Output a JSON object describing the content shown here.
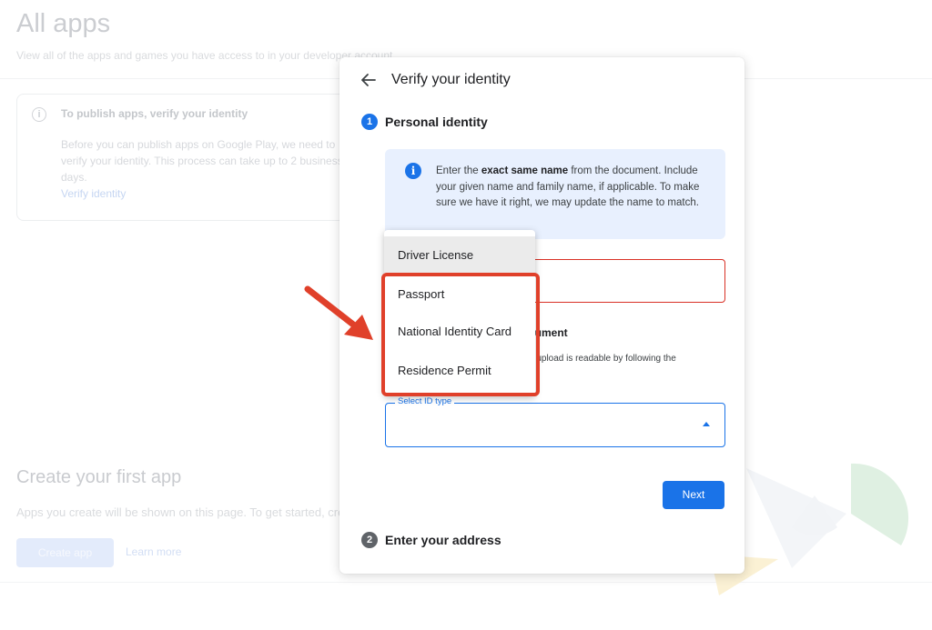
{
  "background": {
    "title": "All apps",
    "subtitle": "View all of the apps and games you have access to in your developer account",
    "notice": {
      "title": "To publish apps, verify your identity",
      "text": "Before you can publish apps on Google Play, we need to verify your identity. This process can take up to 2 business days.",
      "link": "Verify identity"
    },
    "create": {
      "title": "Create your first app",
      "text": "Apps you create will be shown on this page. To get started, create your first app.",
      "button": "Create app",
      "link": "Learn more"
    }
  },
  "modal": {
    "title": "Verify your identity",
    "step1": {
      "number": "1",
      "label": "Personal identity"
    },
    "info": {
      "prefix": "Enter the ",
      "bold": "exact same name",
      "suffix": " from the document. Include your given name and family name, if applicable. To make sure we have it right, we may update the name to match."
    },
    "document_heading_fragment": "cument",
    "document_desc_fragment": "u upload is readable by following the",
    "select": {
      "label": "Select ID type",
      "value": ""
    },
    "next_button": "Next",
    "step2": {
      "number": "2",
      "label": "Enter your address"
    }
  },
  "dropdown": {
    "options": [
      "Driver License",
      "Passport",
      "National Identity Card",
      "Residence Permit"
    ],
    "highlighted_index": 0
  },
  "colors": {
    "accent": "#1a73e8",
    "error": "#d93025",
    "annotation_red": "#e0402a"
  }
}
